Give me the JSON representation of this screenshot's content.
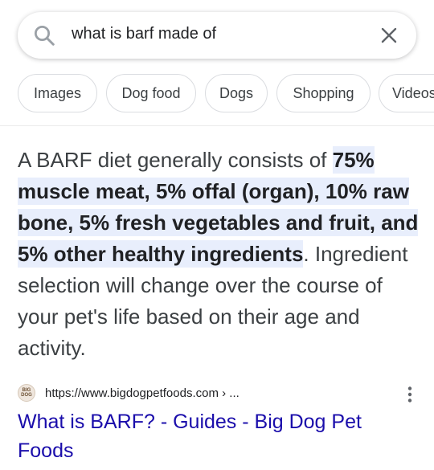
{
  "search": {
    "query": "what is barf made of"
  },
  "chips": [
    {
      "label": "Images"
    },
    {
      "label": "Dog food"
    },
    {
      "label": "Dogs"
    },
    {
      "label": "Shopping"
    },
    {
      "label": "Videos"
    }
  ],
  "answer": {
    "lead": "A BARF diet generally consists of ",
    "highlight": "75% muscle meat, 5% offal (organ), 10% raw bone, 5% fresh vegetables and fruit, and 5% other healthy ingredients",
    "tail": ". Ingredient selection will change over the course of your pet's life based on their age and activity."
  },
  "source": {
    "favicon_text_top": "BIG",
    "favicon_text_bottom": "DOG",
    "url": "https://www.bigdogpetfoods.com › ...",
    "title": "What is BARF? - Guides - Big Dog Pet Foods"
  },
  "colors": {
    "link": "#1a0dab",
    "highlight_bg": "#e8eefc"
  }
}
